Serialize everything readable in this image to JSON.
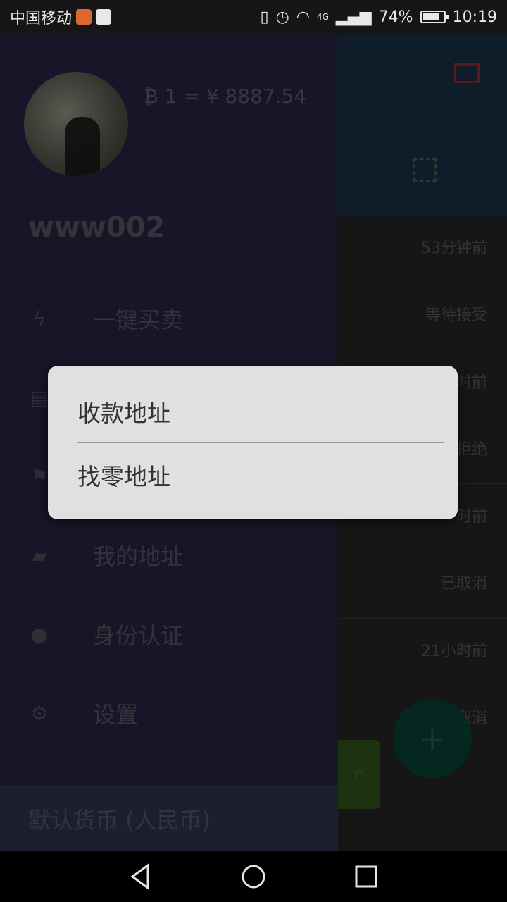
{
  "status_bar": {
    "carrier": "中国移动",
    "network_label": "4G",
    "battery": "74%",
    "time": "10:19"
  },
  "drawer": {
    "rate": "₿ 1 = ¥ 8887.54",
    "username": "www002",
    "menu": [
      {
        "icon": "bolt-icon",
        "label": "一键买卖"
      },
      {
        "icon": "document-icon",
        "label": ""
      },
      {
        "icon": "flag-icon",
        "label": ""
      },
      {
        "icon": "book-icon",
        "label": "我的地址"
      },
      {
        "icon": "user-icon",
        "label": "身份认证"
      },
      {
        "icon": "gear-icon",
        "label": "设置"
      }
    ],
    "footer": "默认货币 (人民币)"
  },
  "main_list": [
    {
      "status": "53分钟前"
    },
    {
      "status": "等待接受"
    },
    {
      "status": "时前"
    },
    {
      "status": "拒绝"
    },
    {
      "status": "时前"
    },
    {
      "status": "已取消"
    },
    {
      "status": "21小时前"
    },
    {
      "status": "已取消"
    }
  ],
  "main": {
    "fab_label": "+",
    "green_button_fragment": "n"
  },
  "dialog": {
    "options": [
      "收款地址",
      "找零地址"
    ]
  },
  "colors": {
    "drawer_bg": "#161628",
    "dialog_bg": "#e0e0e0",
    "header_bg": "#0f1d2a",
    "fab_bg": "#04281f"
  }
}
